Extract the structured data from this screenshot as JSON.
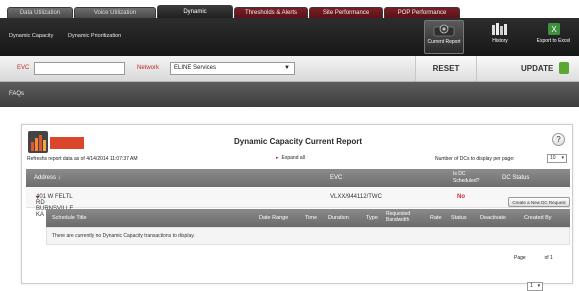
{
  "tabs": [
    {
      "label": "Data Utilization"
    },
    {
      "label": "Voice Utilization"
    },
    {
      "label": "Dynamic"
    },
    {
      "label": "Thresholds & Alerts"
    },
    {
      "label": "Site Performance"
    },
    {
      "label": "POP Performance"
    }
  ],
  "toolbar": {
    "links": [
      "Dynamic Capacity",
      "Dynamic Prioritization"
    ],
    "buttons": [
      {
        "label": "Current Report",
        "icon": "report-icon"
      },
      {
        "label": "History",
        "icon": "history-icon"
      },
      {
        "label": "Export to Excel",
        "icon": "excel-icon"
      }
    ]
  },
  "filters": {
    "evc_label": "EVC",
    "evc_value": "",
    "network_label": "Network",
    "network_value": "ELINE Services",
    "reset_label": "RESET",
    "update_label": "UPDATE"
  },
  "faqs_label": "FAQs",
  "report": {
    "logo_text": "DYNAMIC CAPACITY",
    "title": "Dynamic Capacity Current Report",
    "help": "?",
    "refresh_text": "Refreshs report data as of 4/14/2014 11:07:37 AM",
    "expand_label": "Expand all",
    "per_page_label": "Number of DCs to display per page:",
    "per_page_value": "10",
    "columns": {
      "address": "Address ↓",
      "evc": "EVC",
      "scheduled": "Is DC Scheduled?",
      "status": "DC Status"
    },
    "row": {
      "address": "401 W FELTL RD BURNSVILLE KA",
      "evc": "VLXX/944112/TWC",
      "scheduled": "No"
    },
    "create_label": "Create a New DC Request",
    "sub_columns": [
      "Schedule Title",
      "Date Range",
      "Time",
      "Duration",
      "Type",
      "Requested Bandwidth",
      "Rate",
      "Status",
      "Deactivate",
      "Created By"
    ],
    "empty_text": "There are currently no Dynamic Capacity transactions to display.",
    "pager": {
      "prefix": "Page",
      "value": "1",
      "suffix": "of 1"
    }
  },
  "colors": {
    "accent_red": "#c0282d",
    "update_green": "#5aa832",
    "header_gray": "#7a7a7a"
  }
}
